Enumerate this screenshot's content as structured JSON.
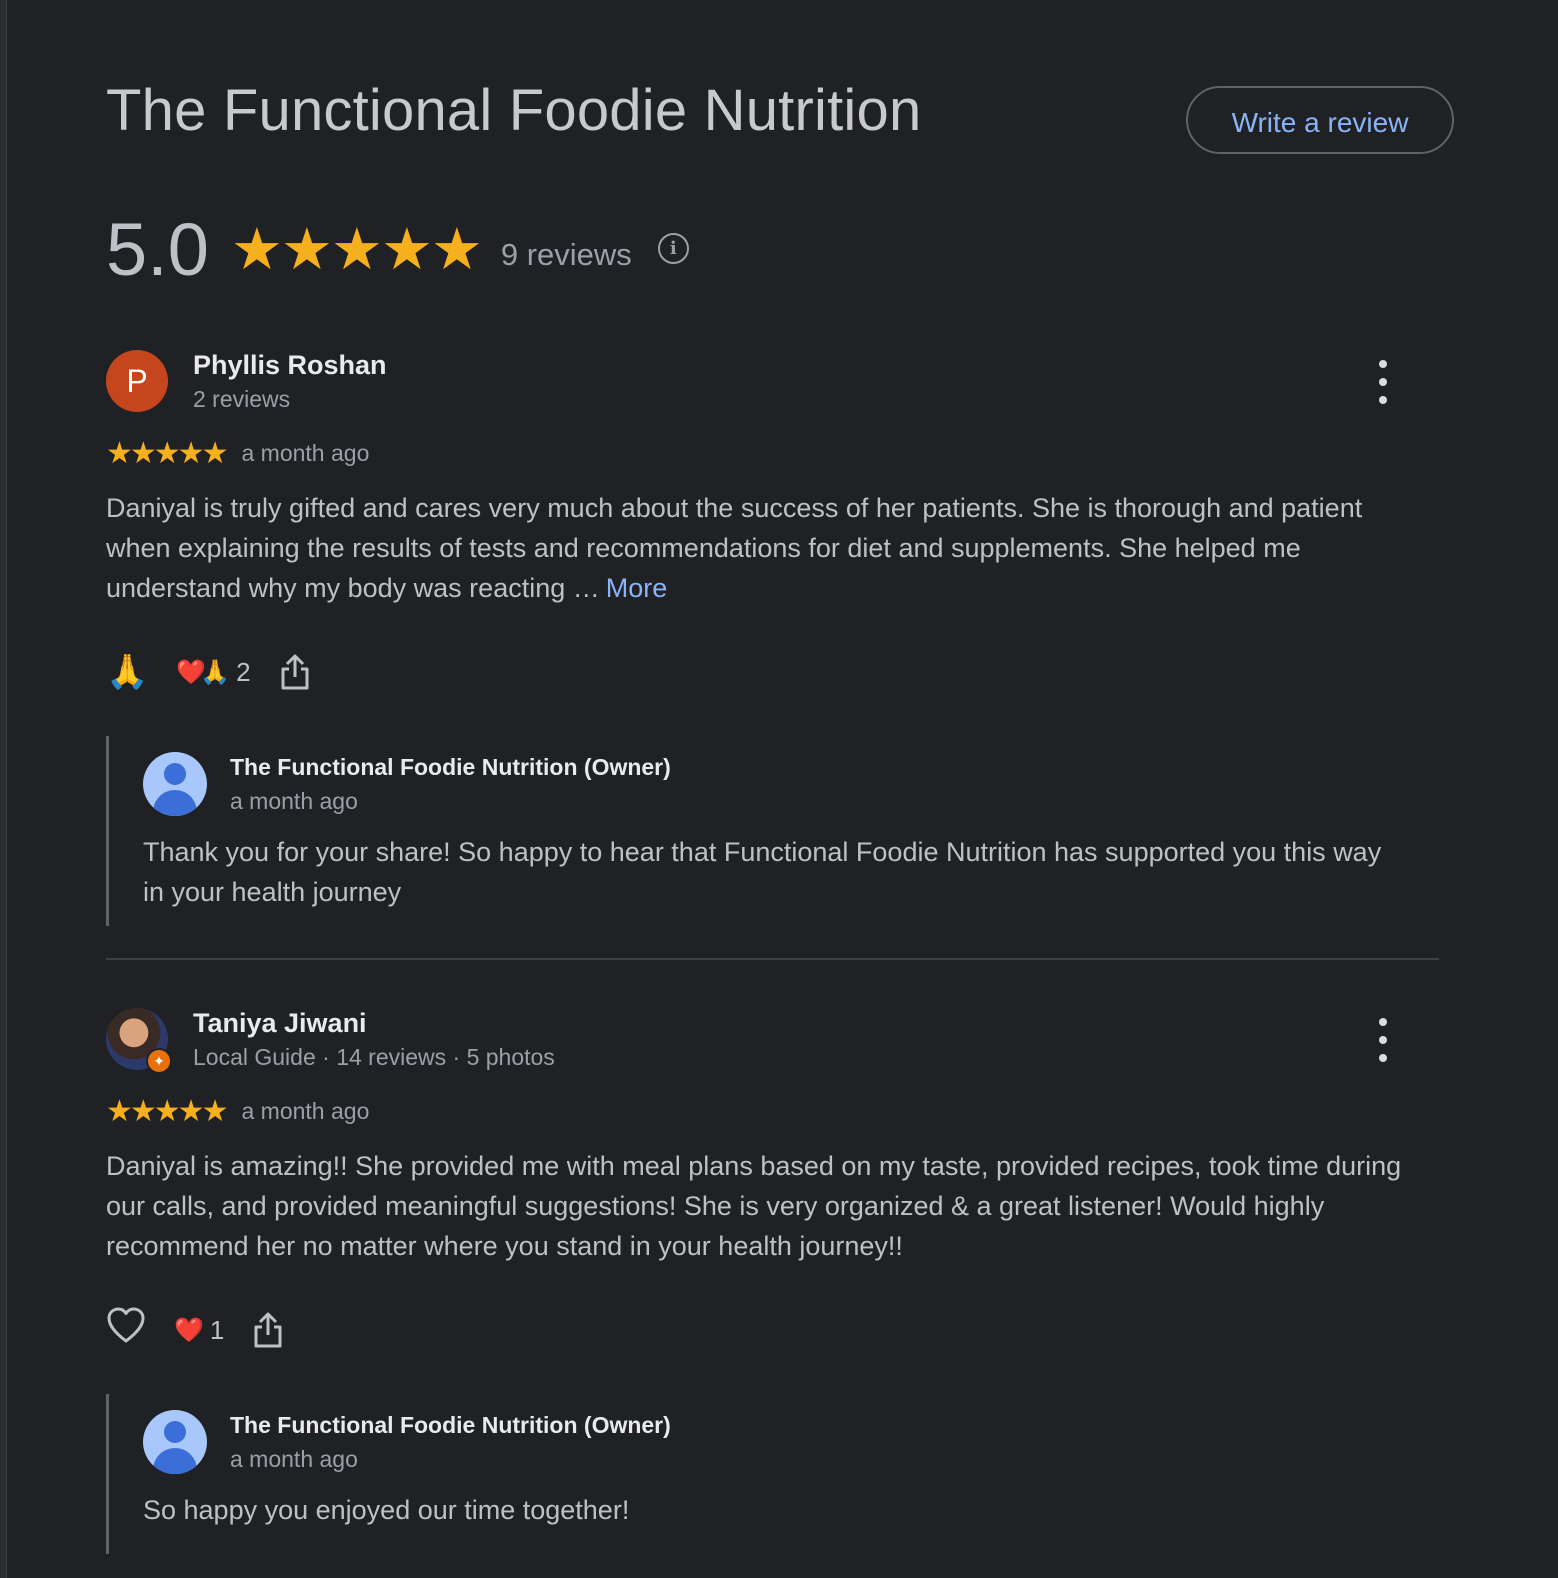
{
  "place": {
    "title": "The Functional Foodie Nutrition",
    "write_review_label": "Write a review",
    "rating": "5.0",
    "rating_stars": "★★★★★",
    "rating_value": 5,
    "review_count_label": "9 reviews",
    "info_icon": "info-icon"
  },
  "colors": {
    "background": "#202124",
    "accent_link": "#8ab4f8",
    "star": "#f6b01d",
    "avatar_p": "#c5461d",
    "owner_avatar": "#a8c7fa"
  },
  "reviews": [
    {
      "avatar_letter": "P",
      "name": "Phyllis Roshan",
      "meta": "2 reviews",
      "stars": "★★★★★",
      "rating_value": 5,
      "time": "a month ago",
      "text": "Daniyal is truly gifted and cares very much about the success of her patients. She is thorough and patient when explaining the results of tests and recommendations for diet and supplements. She helped me understand why my body was reacting …",
      "more_label": "More",
      "action_emoji": "🙏",
      "reaction_emojis": "❤️🙏",
      "reaction_count": "2",
      "owner_reply": {
        "name": "The Functional Foodie Nutrition (Owner)",
        "time": "a month ago",
        "text": "Thank you for your share! So happy to hear that Functional Foodie Nutrition has supported you this way in your health journey"
      }
    },
    {
      "avatar_letter": "",
      "name": "Taniya Jiwani",
      "meta": "Local Guide · 14 reviews · 5 photos",
      "stars": "★★★★★",
      "rating_value": 5,
      "time": "a month ago",
      "text": "Daniyal is amazing!! She provided me with meal plans based on my taste, provided recipes, took time during our calls, and provided meaningful suggestions! She is very organized & a great listener! Would highly recommend her no matter where you stand in your health journey!!",
      "action_icon": "heart-outline-icon",
      "reaction_emojis": "❤️",
      "reaction_count": "1",
      "owner_reply": {
        "name": "The Functional Foodie Nutrition (Owner)",
        "time": "a month ago",
        "text": "So happy you enjoyed our time together!"
      }
    }
  ]
}
